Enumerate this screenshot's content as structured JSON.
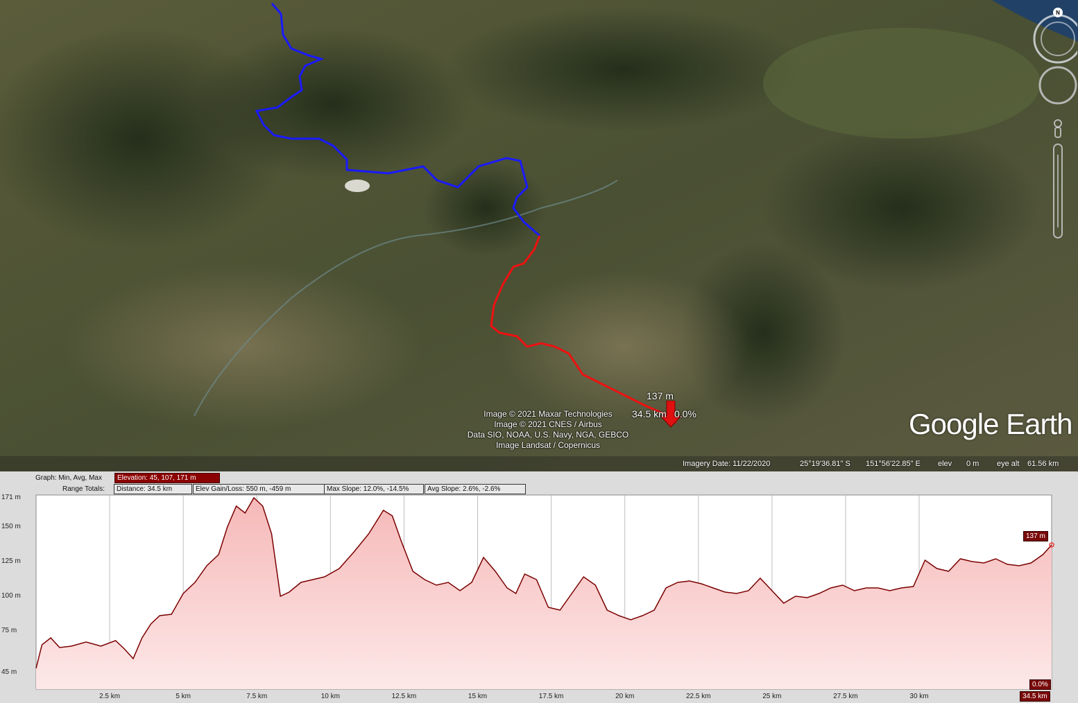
{
  "map": {
    "attribution": [
      "Image © 2021 Maxar Technologies",
      "Image © 2021 CNES / Airbus",
      "Data SIO, NOAA, U.S. Navy, NGA, GEBCO",
      "Image Landsat / Copernicus"
    ],
    "marker": {
      "elevation": "137 m",
      "distance": "34.5 km",
      "slope": "0.0%"
    },
    "logo": {
      "google": "Google",
      "earth": "Earth"
    },
    "north_label": "N",
    "status": {
      "imagery_date": "Imagery Date: 11/22/2020",
      "latitude": "25°19'36.81\" S",
      "longitude": "151°56'22.85\" E",
      "elev_label": "elev",
      "elev_value": "0 m",
      "eye_label": "eye alt",
      "eye_value": "61.56 km"
    },
    "colors": {
      "route_before": "#1a1aff",
      "route_after": "#ee1111"
    }
  },
  "profile": {
    "graph_label": "Graph: Min, Avg, Max",
    "elevation_stats": "Elevation: 45, 107, 171 m",
    "range_label": "Range Totals:",
    "distance": "Distance: 34.5 km",
    "gain_loss": "Elev Gain/Loss: 550 m, -459 m",
    "max_slope": "Max Slope: 12.0%, -14.5%",
    "avg_slope": "Avg Slope: 2.6%, -2.6%",
    "current_elev_tag": "137 m",
    "current_slope_tag": "0.0%",
    "current_dist_tag": "34.5 km"
  },
  "chart_data": {
    "type": "area",
    "xlabel": "",
    "ylabel": "",
    "x_ticks": [
      2.5,
      5,
      7.5,
      10,
      12.5,
      15,
      17.5,
      20,
      22.5,
      25,
      27.5,
      30
    ],
    "x_tick_labels": [
      "2.5 km",
      "5 km",
      "7.5 km",
      "10 km",
      "12.5 km",
      "15 km",
      "17.5 km",
      "20 km",
      "22.5 km",
      "25 km",
      "27.5 km",
      "30 km"
    ],
    "y_ticks": [
      45,
      75,
      100,
      125,
      150,
      171
    ],
    "y_tick_labels": [
      "45 m",
      "75 m",
      "100 m",
      "125 m",
      "150 m",
      "171 m"
    ],
    "xlim": [
      0,
      34.5
    ],
    "ylim": [
      33,
      173
    ],
    "series": [
      {
        "x": [
          0,
          0.2,
          0.5,
          0.8,
          1.2,
          1.7,
          2.2,
          2.7,
          3.0,
          3.3,
          3.6,
          3.9,
          4.2,
          4.6,
          5.0,
          5.4,
          5.8,
          6.2,
          6.5,
          6.8,
          7.1,
          7.4,
          7.7,
          8.0,
          8.3,
          8.6,
          9.0,
          9.4,
          9.8,
          10.3,
          10.8,
          11.3,
          11.8,
          12.1,
          12.4,
          12.8,
          13.2,
          13.6,
          14.0,
          14.4,
          14.8,
          15.2,
          15.6,
          16.0,
          16.3,
          16.6,
          17.0,
          17.4,
          17.8,
          18.2,
          18.6,
          19.0,
          19.4,
          19.8,
          20.2,
          20.6,
          21.0,
          21.4,
          21.8,
          22.2,
          22.6,
          23.0,
          23.4,
          23.8,
          24.2,
          24.6,
          25.0,
          25.4,
          25.8,
          26.2,
          26.6,
          27.0,
          27.4,
          27.8,
          28.2,
          28.6,
          29.0,
          29.4,
          29.8,
          30.2,
          30.6,
          31.0,
          31.4,
          31.8,
          32.2,
          32.6,
          33.0,
          33.4,
          33.8,
          34.2,
          34.5
        ],
        "y": [
          48,
          65,
          70,
          63,
          64,
          67,
          64,
          68,
          62,
          55,
          70,
          80,
          86,
          87,
          102,
          110,
          122,
          130,
          150,
          165,
          160,
          171,
          165,
          145,
          100,
          103,
          110,
          112,
          114,
          120,
          132,
          145,
          162,
          158,
          140,
          118,
          112,
          108,
          110,
          104,
          110,
          128,
          118,
          106,
          102,
          116,
          112,
          92,
          90,
          102,
          114,
          108,
          90,
          86,
          83,
          86,
          90,
          106,
          110,
          111,
          109,
          106,
          103,
          102,
          104,
          113,
          104,
          95,
          100,
          99,
          102,
          106,
          108,
          104,
          106,
          106,
          104,
          106,
          107,
          126,
          120,
          118,
          127,
          125,
          124,
          127,
          123,
          122,
          124,
          130,
          137
        ]
      }
    ],
    "grid": true,
    "fill_color": "#f7c9c9",
    "line_color": "#7a0000"
  }
}
